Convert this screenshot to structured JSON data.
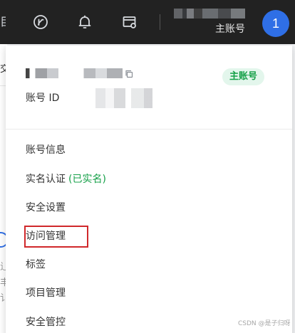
{
  "topbar": {
    "edge_glyph": "目",
    "icons": [
      "app-icon",
      "bell-icon",
      "console-settings-icon"
    ],
    "account_label": "主账号",
    "avatar_initial": "1"
  },
  "background": {
    "frag_top": "交",
    "frag_bottom": [
      "辶",
      "丰",
      "讠"
    ]
  },
  "dropdown": {
    "badge": "主账号",
    "account_id_label": "账号 ID",
    "menu": [
      {
        "label": "账号信息"
      },
      {
        "label": "实名认证",
        "status": "(已实名)"
      },
      {
        "label": "安全设置"
      },
      {
        "label": "访问管理",
        "highlighted": true
      },
      {
        "label": "标签"
      },
      {
        "label": "项目管理"
      },
      {
        "label": "安全管控"
      }
    ]
  },
  "watermark": "CSDN @是子归呀",
  "colors": {
    "topbar_bg": "#222222",
    "avatar_bg": "#2f6fe6",
    "verified_green": "#15a048",
    "badge_bg": "#e3f6ec",
    "highlight_red": "#d0282b"
  }
}
